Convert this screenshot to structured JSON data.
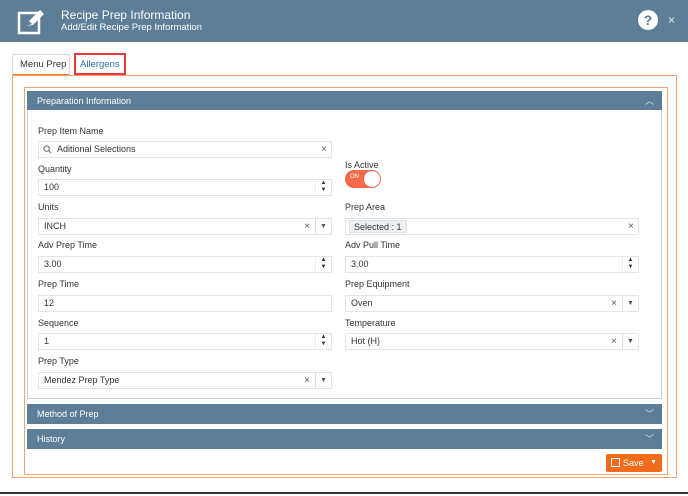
{
  "window": {
    "title": "Recipe Prep Information",
    "subtitle": "Add/Edit Recipe Prep Information",
    "help_icon": "?",
    "close_icon": "×"
  },
  "tabs": [
    {
      "label": "Menu Prep"
    },
    {
      "label": "Allergens"
    }
  ],
  "sections": {
    "prep_info": "Preparation Information",
    "method": "Method of Prep",
    "history": "History"
  },
  "form": {
    "prep_item_name": {
      "label": "Prep Item Name",
      "value": "Aditional Selections"
    },
    "quantity": {
      "label": "Quantity",
      "value": "100"
    },
    "is_active": {
      "label": "Is Active",
      "toggle_text": "ON",
      "state": true
    },
    "units": {
      "label": "Units",
      "value": "INCH"
    },
    "prep_area": {
      "label": "Prep Area",
      "value": "Selected : 1"
    },
    "adv_prep_time": {
      "label": "Adv Prep Time",
      "value": "3.00"
    },
    "adv_pull_time": {
      "label": "Adv Pull Time",
      "value": "3.00"
    },
    "prep_time": {
      "label": "Prep Time",
      "value": "12"
    },
    "prep_equipment": {
      "label": "Prep Equipment",
      "value": "Oven"
    },
    "sequence": {
      "label": "Sequence",
      "value": "1"
    },
    "temperature": {
      "label": "Temperature",
      "value": "Hot (H)"
    },
    "prep_type": {
      "label": "Prep Type",
      "value": "Mendez Prep Type"
    }
  },
  "symbols": {
    "clear": "×",
    "caret_down": "▼",
    "spin_up": "▲",
    "spin_down": "▼",
    "chevron_up": "︿",
    "chevron_down": "﹀",
    "search": "🔍"
  },
  "save_button": {
    "label": "Save"
  },
  "colors": {
    "header": "#5d7e96",
    "accent": "#f26a1b",
    "highlight": "#e53935",
    "link": "#2f6fb0"
  }
}
